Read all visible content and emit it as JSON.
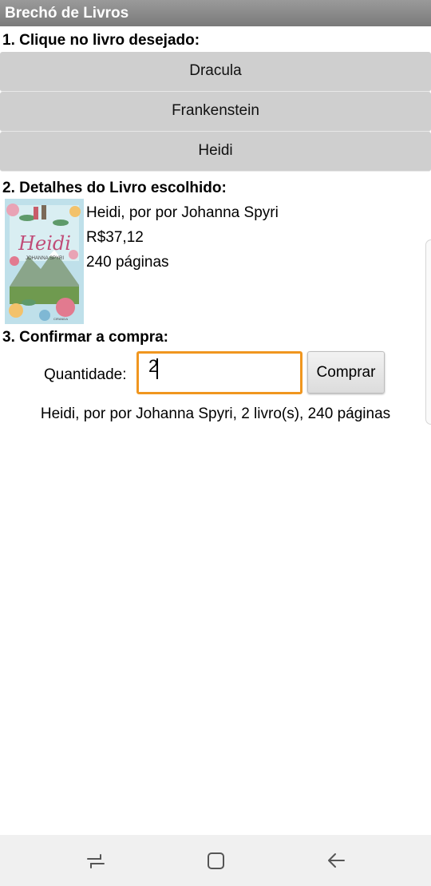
{
  "app": {
    "title": "Brechó de Livros"
  },
  "step1": {
    "heading": "1. Clique no livro desejado:",
    "books": [
      {
        "label": "Dracula"
      },
      {
        "label": "Frankenstein"
      },
      {
        "label": "Heidi"
      }
    ]
  },
  "step2": {
    "heading": "2. Detalhes do Livro escolhido:",
    "cover": {
      "title": "Heidi",
      "author": "JOHANNA SPYRI",
      "publisher": "CIRANDA",
      "icon": "book-cover-image"
    },
    "title_line": "Heidi, por por Johanna Spyri",
    "price": "R$37,12",
    "pages": "240 páginas"
  },
  "step3": {
    "heading": "3. Confirmar a compra:",
    "quantity_label": "Quantidade:",
    "quantity_value": "2",
    "buy_label": "Comprar",
    "summary": "Heidi, por por Johanna Spyri, 2 livro(s), 240 páginas"
  },
  "navbar": {
    "icons": [
      "recent-apps-icon",
      "home-icon",
      "back-icon"
    ]
  },
  "colors": {
    "titlebar": "#8a8a8a",
    "book_button": "#cfcfcf",
    "input_focus": "#f0961f",
    "navbar": "#f0f0f0"
  }
}
